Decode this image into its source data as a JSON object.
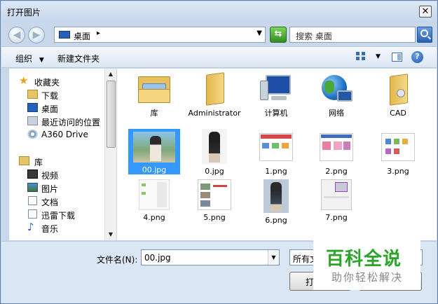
{
  "window": {
    "title": "打开图片",
    "close_glyph": "✕"
  },
  "address": {
    "location": "桌面",
    "search_placeholder": "搜索 桌面"
  },
  "toolbar": {
    "organize": "组织",
    "new_folder": "新建文件夹"
  },
  "sidebar": {
    "favorites_label": "收藏夹",
    "favorites": [
      "下载",
      "桌面",
      "最近访问的位置",
      "A360 Drive"
    ],
    "libraries_label": "库",
    "libraries": [
      "视频",
      "图片",
      "文档",
      "迅雷下载",
      "音乐"
    ]
  },
  "files": {
    "row1": [
      "库",
      "Administrator",
      "计算机",
      "网络",
      "CAD"
    ],
    "row2": [
      "00.jpg",
      "0.jpg",
      "1.png",
      "2.png",
      "3.png"
    ],
    "row3": [
      "4.png",
      "5.png",
      "6.png",
      "7.png"
    ]
  },
  "footer": {
    "filename_label": "文件名(N):",
    "filename_value": "00.jpg",
    "filetype_value": "所有文",
    "open_label": "打"
  },
  "watermark": {
    "main": "百科全说",
    "sub": "助你轻松解决"
  },
  "icons": {
    "back": "back-arrow-icon",
    "forward": "forward-arrow-icon",
    "refresh": "refresh-icon",
    "search": "search-icon",
    "help": "help-icon"
  }
}
